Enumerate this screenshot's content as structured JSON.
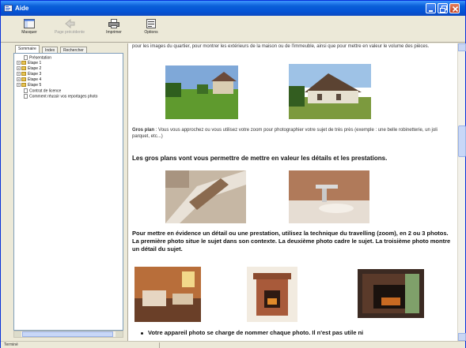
{
  "window": {
    "title": "Aide"
  },
  "toolbar": {
    "buttons": [
      {
        "label": "Masquer",
        "icon": "hide-pane-icon",
        "enabled": true
      },
      {
        "label": "Page précédente",
        "icon": "back-arrow-icon",
        "enabled": false
      },
      {
        "label": "Imprimer",
        "icon": "printer-icon",
        "enabled": true
      },
      {
        "label": "Options",
        "icon": "options-icon",
        "enabled": true
      }
    ]
  },
  "nav": {
    "tabs": [
      "Sommaire",
      "Index",
      "Rechercher"
    ],
    "active_tab": "Sommaire",
    "tree": [
      {
        "label": "Présentation",
        "type": "page",
        "expander": ""
      },
      {
        "label": "Étape 1",
        "type": "folder",
        "expander": "+"
      },
      {
        "label": "Étape 2",
        "type": "folder",
        "expander": "+"
      },
      {
        "label": "Étape 3",
        "type": "folder",
        "expander": "+"
      },
      {
        "label": "Étape 4",
        "type": "folder",
        "expander": "+"
      },
      {
        "label": "Étape 5",
        "type": "folder",
        "expander": "+"
      },
      {
        "label": "Contrat de licence",
        "type": "page",
        "expander": ""
      },
      {
        "label": "Comment réussir vos reportages photo",
        "type": "page",
        "expander": ""
      }
    ]
  },
  "content": {
    "intro": "pour les images du quartier, pour montrer les extérieurs de la maison ou de l'immeuble, ainsi que pour mettre en valeur le volume des pièces.",
    "closeup_term": "Gros plan",
    "closeup_text": " : Vous vous approchez ou vous utilisez votre zoom pour photographier votre sujet de très près (exemple : une belle robinetterie, un joli parquet, etc...)",
    "closeup_heading": "Les gros plans vont vous permettre de mettre en valeur les détails et les prestations.",
    "travelling_text": "Pour mettre en évidence un détail ou une prestation, utilisez la technique du travelling (zoom), en 2 ou 3 photos. La première photo situe le sujet dans son contexte. La deuxième photo cadre le sujet. La troisième photo montre un détail du sujet.",
    "bullet_text": "Votre appareil photo se charge de nommer chaque photo. Il n'est pas utile ni"
  },
  "status": {
    "left": "Terminé",
    "right": ""
  },
  "colors": {
    "titlebar": "#0554d6",
    "window_bg": "#ece9d8",
    "close_button": "#c3401f"
  }
}
